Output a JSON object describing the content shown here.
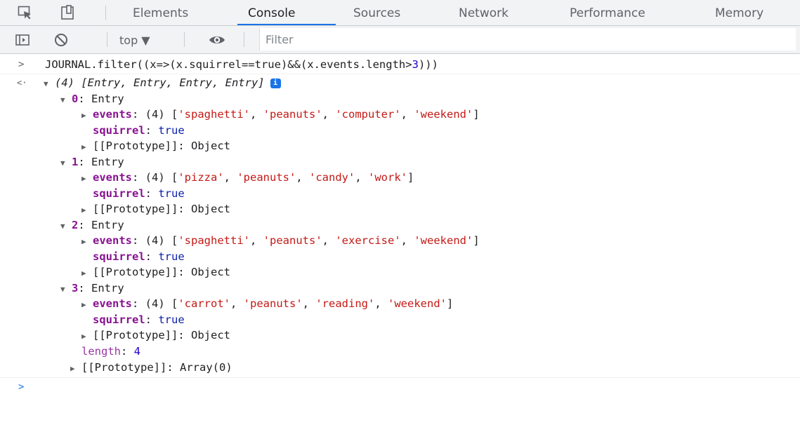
{
  "tabs": [
    {
      "label": "Elements"
    },
    {
      "label": "Console"
    },
    {
      "label": "Sources"
    },
    {
      "label": "Network"
    },
    {
      "label": "Performance"
    },
    {
      "label": "Memory"
    }
  ],
  "toolbar": {
    "context_label": "top ▼",
    "filter_placeholder": "Filter"
  },
  "console": {
    "input_prompt": ">",
    "result_prompt": "<·",
    "command_parts": {
      "pre": "JOURNAL.filter((x=>(x.squirrel==true)&&(x.events.length>",
      "num": "3",
      "post": ")))"
    },
    "result_summary": {
      "count": "(4)",
      "types": "[Entry, Entry, Entry, Entry]",
      "badge": "i"
    },
    "entries": [
      {
        "index": "0",
        "type": "Entry",
        "events_count": "(4)",
        "events": [
          "'spaghetti'",
          "'peanuts'",
          "'computer'",
          "'weekend'"
        ],
        "squirrel": "true",
        "prototype": "Object"
      },
      {
        "index": "1",
        "type": "Entry",
        "events_count": "(4)",
        "events": [
          "'pizza'",
          "'peanuts'",
          "'candy'",
          "'work'"
        ],
        "squirrel": "true",
        "prototype": "Object"
      },
      {
        "index": "2",
        "type": "Entry",
        "events_count": "(4)",
        "events": [
          "'spaghetti'",
          "'peanuts'",
          "'exercise'",
          "'weekend'"
        ],
        "squirrel": "true",
        "prototype": "Object"
      },
      {
        "index": "3",
        "type": "Entry",
        "events_count": "(4)",
        "events": [
          "'carrot'",
          "'peanuts'",
          "'reading'",
          "'weekend'"
        ],
        "squirrel": "true",
        "prototype": "Object"
      }
    ],
    "length_key": "length",
    "length_value": "4",
    "array_prototype": "Array(0)",
    "keys": {
      "events": "events",
      "squirrel": "squirrel",
      "prototype": "[[Prototype]]"
    },
    "empty_prompt": ">"
  },
  "colors": {
    "accent": "#1a73e8",
    "string": "#c41a16",
    "number": "#1c00cf",
    "key": "#881391"
  }
}
